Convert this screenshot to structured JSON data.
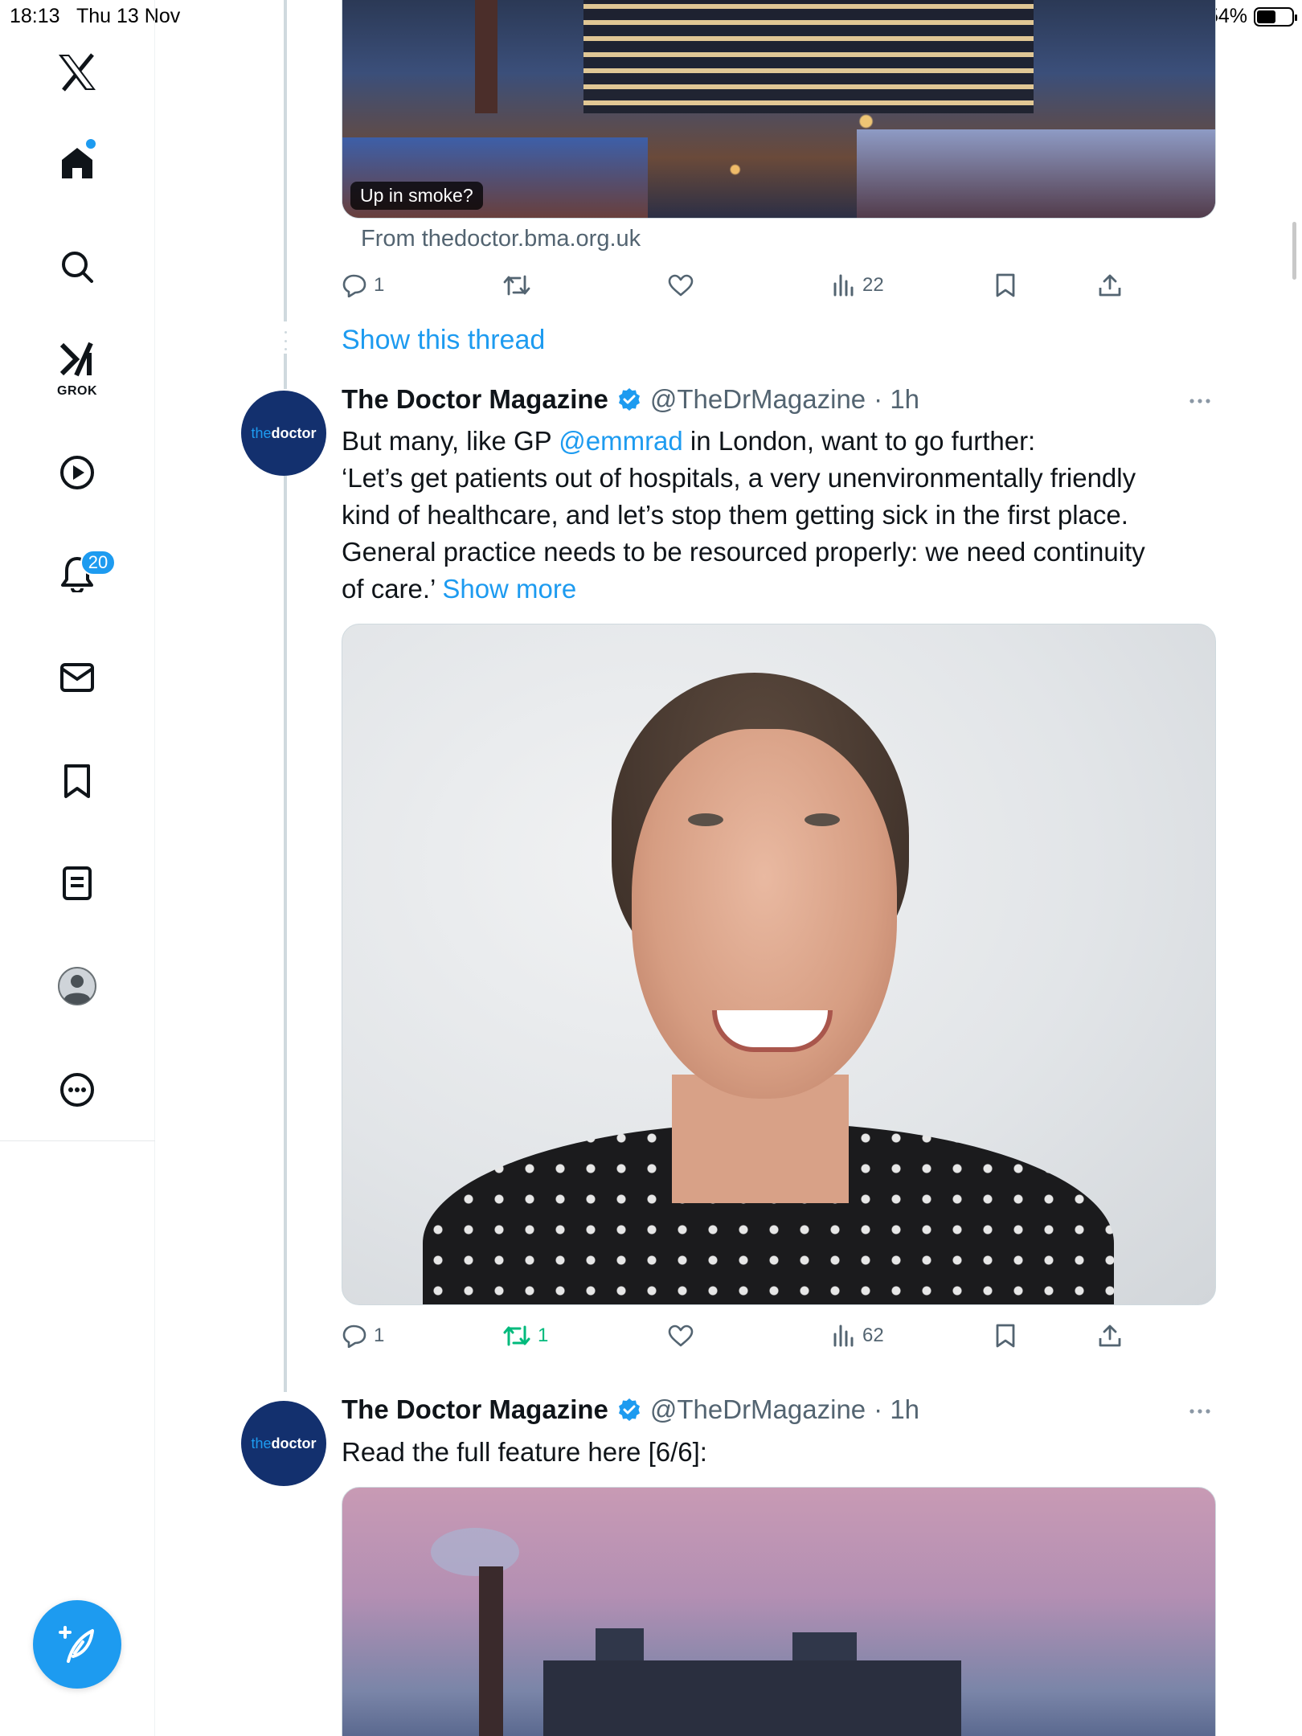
{
  "status_bar": {
    "time": "18:13",
    "date": "Thu 13 Nov",
    "battery": "54%"
  },
  "sidebar": {
    "items": [
      {
        "name": "x-logo"
      },
      {
        "name": "home"
      },
      {
        "name": "search"
      },
      {
        "name": "grok",
        "label": "GROK"
      },
      {
        "name": "video"
      },
      {
        "name": "notifications",
        "badge": "20"
      },
      {
        "name": "messages"
      },
      {
        "name": "bookmarks"
      },
      {
        "name": "lists"
      },
      {
        "name": "profile"
      },
      {
        "name": "more"
      }
    ]
  },
  "previous_tweet": {
    "image_caption": "Up in smoke?",
    "link_source": "From thedoctor.bma.org.uk",
    "actions": {
      "replies": "1",
      "retweets": "",
      "likes": "",
      "views": "22"
    }
  },
  "show_thread": "Show this thread",
  "tweets": [
    {
      "avatar": {
        "prefix": "the",
        "suffix": "doctor"
      },
      "name": "The Doctor Magazine",
      "handle": "@TheDrMagazine",
      "time": "· 1h",
      "text_prefix": "But many, like GP ",
      "mention": "@emmrad",
      "text_suffix": " in London, want to go further:",
      "text_lines": [
        "‘Let’s get patients out of hospitals, a very unenvironmentally friendly",
        "kind of healthcare, and let’s stop them getting sick in the first place.",
        "General practice needs to be resourced properly: we need continuity"
      ],
      "text_last": "of care.’ ",
      "show_more": "Show more",
      "actions": {
        "replies": "1",
        "retweets": "1",
        "likes": "",
        "views": "62"
      }
    },
    {
      "avatar": {
        "prefix": "the",
        "suffix": "doctor"
      },
      "name": "The Doctor Magazine",
      "handle": "@TheDrMagazine",
      "time": "· 1h",
      "text": "Read the full feature here [6/6]:"
    }
  ],
  "colors": {
    "accent": "#1d9bf0",
    "retweet_active": "#00ba7c",
    "muted": "#536471",
    "avatar_bg": "#13306e"
  }
}
